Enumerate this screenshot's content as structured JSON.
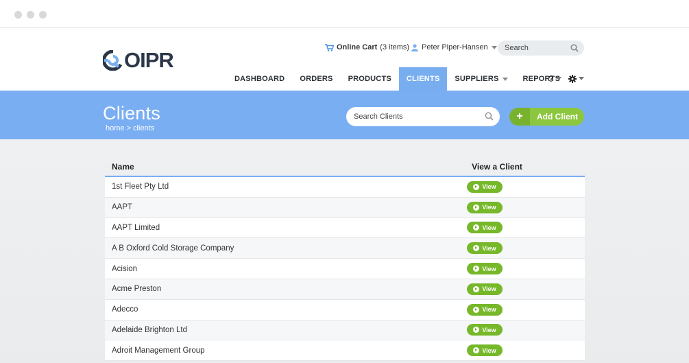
{
  "brand": {
    "logo_text": "OIPR",
    "accent": "#79aef2",
    "dark": "#2c3748",
    "green": "#8cc63e"
  },
  "header": {
    "cart_label": "Online Cart",
    "cart_items": "(3 items)",
    "user_name": "Peter Piper-Hansen",
    "search_placeholder": "Search"
  },
  "nav": {
    "items": [
      {
        "label": "DASHBOARD"
      },
      {
        "label": "ORDERS"
      },
      {
        "label": "PRODUCTS"
      },
      {
        "label": "CLIENTS",
        "active": true
      },
      {
        "label": "SUPPLIERS"
      },
      {
        "label": "REPORTS"
      }
    ],
    "help_label": "?"
  },
  "page": {
    "title": "Clients",
    "breadcrumb": "home > clients",
    "search_placeholder": "Search Clients",
    "add_button": "Add Client"
  },
  "table": {
    "headers": {
      "name": "Name",
      "view": "View a Client"
    },
    "view_label": "View",
    "rows": [
      {
        "name": "1st Fleet Pty Ltd"
      },
      {
        "name": "AAPT"
      },
      {
        "name": "AAPT Limited"
      },
      {
        "name": "A B Oxford Cold Storage Company"
      },
      {
        "name": "Acision"
      },
      {
        "name": "Acme Preston"
      },
      {
        "name": "Adecco"
      },
      {
        "name": "Adelaide Brighton Ltd"
      },
      {
        "name": "Adroit Management Group"
      }
    ]
  }
}
